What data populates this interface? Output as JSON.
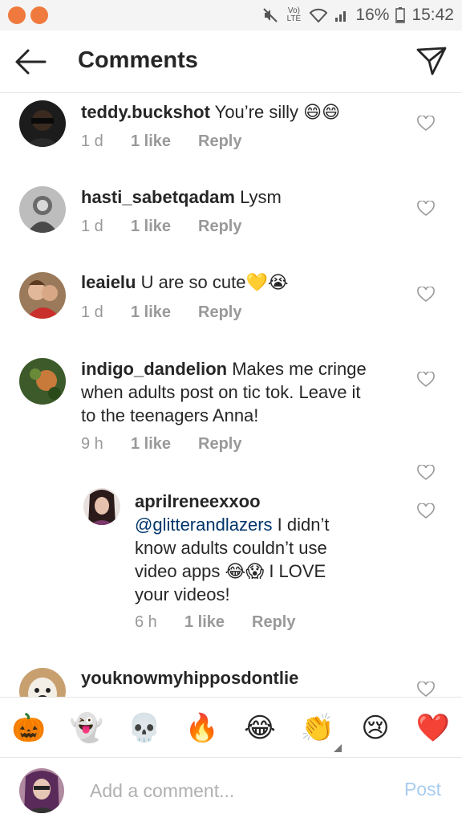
{
  "status_bar": {
    "battery": "16%",
    "time": "15:42",
    "lte": "Vo) LTE"
  },
  "header": {
    "title": "Comments"
  },
  "comments": [
    {
      "username": "teddy.buckshot",
      "text": "You’re silly",
      "emoji": "😄😄",
      "time": "1 d",
      "likes": "1 like",
      "reply": "Reply"
    },
    {
      "username": "hasti_sabetqadam",
      "text": "Lysm",
      "emoji": "",
      "time": "1 d",
      "likes": "1 like",
      "reply": "Reply"
    },
    {
      "username": "leaielu",
      "text": "U are so cute",
      "emoji": "💛😭",
      "time": "1 d",
      "likes": "1 like",
      "reply": "Reply"
    },
    {
      "username": "indigo_dandelion",
      "text_line1": "Makes me cringe",
      "text_line2": "when adults post on tic tok. Leave it",
      "text_line3": "to the teenagers Anna!",
      "time": "9 h",
      "likes": "1 like",
      "reply": "Reply"
    },
    {
      "username": "aprilreneexxoo",
      "mention": "@glitterandlazers",
      "text_line1": "I didn’t",
      "text_line2": "know adults couldn’t use",
      "text_line3": "video apps",
      "emoji": "😂😱",
      "text_line3b": "I LOVE",
      "text_line4": "your videos!",
      "time": "6 h",
      "likes": "1 like",
      "reply": "Reply"
    },
    {
      "username": "youknowmyhipposdontlie"
    }
  ],
  "emoji_bar": [
    "🎃",
    "👻",
    "💀",
    "🔥",
    "😂",
    "👏",
    "😢",
    "❤️"
  ],
  "input": {
    "placeholder": "Add a comment...",
    "post_label": "Post"
  },
  "colors": {
    "accent": "#f07a3e",
    "post_disabled": "#a8cdef",
    "meta": "#999999",
    "mention": "#003569"
  }
}
